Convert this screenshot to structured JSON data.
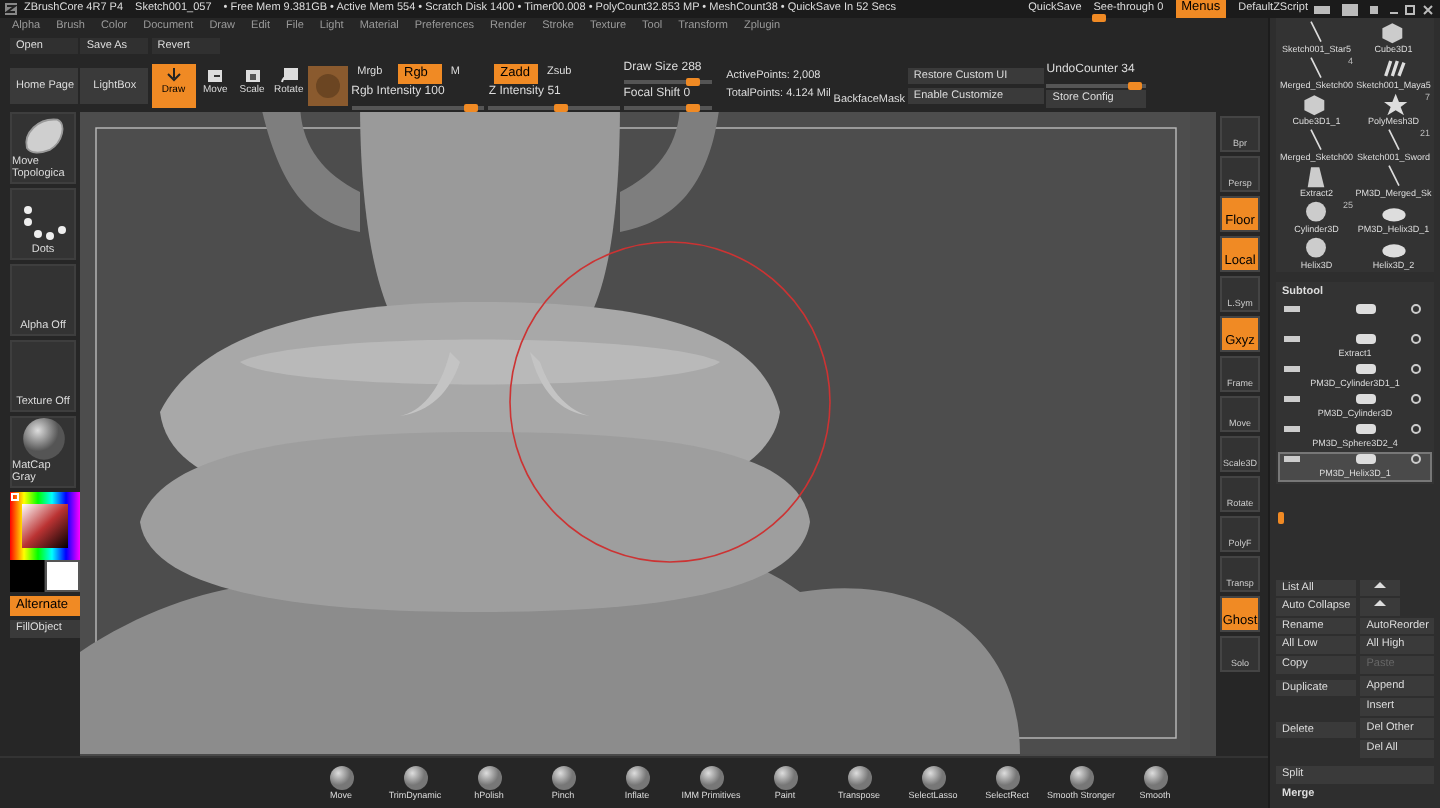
{
  "title_bar": {
    "app": "ZBrushCore 4R7 P4",
    "document": "Sketch001_057",
    "stats": "• Free Mem 9.381GB • Active Mem 554 • Scratch Disk 1400 • Timer00.008 • PolyCount32.853 MP • MeshCount38 • QuickSave In 52 Secs",
    "quicksave": "QuickSave",
    "see_through": {
      "label": "See-through  0",
      "level": 0.05
    },
    "menus": {
      "label": "Menus",
      "on": true
    },
    "script": "DefaultZScript"
  },
  "menu_bar": [
    "Alpha",
    "Brush",
    "Color",
    "Document",
    "Draw",
    "Edit",
    "File",
    "Light",
    "Material",
    "Preferences",
    "Render",
    "Stroke",
    "Texture",
    "Tool",
    "Transform",
    "Zplugin"
  ],
  "file_buttons": [
    "Open",
    "Save As",
    "Revert"
  ],
  "toolbar": {
    "buttons": [
      "Home Page",
      "LightBox"
    ],
    "modes": [
      {
        "label": "Draw",
        "selected": true,
        "kind": "draw"
      },
      {
        "label": "Move",
        "selected": false,
        "kind": "move"
      },
      {
        "label": "Scale",
        "selected": false,
        "kind": "scale"
      },
      {
        "label": "Rotate",
        "selected": false,
        "kind": "rotate"
      }
    ],
    "color_modes": [
      {
        "label": "Mrgb",
        "selected": false
      },
      {
        "label": "Rgb",
        "selected": true
      },
      {
        "label": "M",
        "selected": false
      }
    ],
    "z_modes": [
      {
        "label": "Zadd",
        "selected": true
      },
      {
        "label": "Zsub",
        "selected": false
      }
    ],
    "intensity": [
      {
        "label": "Rgb Intensity 100",
        "level": 0.95
      },
      {
        "label": "Z Intensity 51",
        "level": 0.55
      }
    ],
    "draw": [
      {
        "label": "Draw Size 288",
        "level": 0.85
      },
      {
        "label": "Focal Shift 0",
        "level": 0.85
      }
    ],
    "points": [
      "ActivePoints: 2,008",
      "TotalPoints: 4.124 Mil"
    ],
    "backface": "BackfaceMask",
    "custom": [
      "Restore Custom UI",
      "Enable Customize"
    ],
    "undo": {
      "label": "UndoCounter 34",
      "level": 0.95
    },
    "store": "Store Config"
  },
  "left_shelf": [
    {
      "label": "Move Topologica",
      "kind": "brush"
    },
    {
      "label": "Dots",
      "kind": "stroke"
    },
    {
      "label": "Alpha Off",
      "kind": "empty"
    },
    {
      "label": "Texture Off",
      "kind": "empty"
    },
    {
      "label": "MatCap Gray",
      "kind": "material"
    }
  ],
  "alternate": {
    "label": "Alternate",
    "on": true
  },
  "fill_object": "FillObject",
  "canvas": {
    "kind": "picture"
  },
  "right_shelf": [
    {
      "label": "Bpr",
      "on": false
    },
    {
      "label": "Persp",
      "on": false
    },
    {
      "label": "Floor",
      "on": true
    },
    {
      "label": "Local",
      "on": true
    },
    {
      "label": "L.Sym",
      "on": false
    },
    {
      "label": "Gxyz",
      "on": true
    },
    {
      "label": "Frame",
      "on": false
    },
    {
      "label": "Move",
      "on": false
    },
    {
      "label": "Scale3D",
      "on": false
    },
    {
      "label": "Rotate",
      "on": false
    },
    {
      "label": "PolyF",
      "on": false
    },
    {
      "label": "Transp",
      "on": false
    },
    {
      "label": "Ghost",
      "on": true
    },
    {
      "label": "Solo",
      "on": false
    }
  ],
  "tools": [
    {
      "name": "Sketch001_Star5",
      "kind": "stick"
    },
    {
      "name": "Cube3D1",
      "kind": "cube"
    },
    {
      "name": "Merged_Sketch00",
      "kind": "stick",
      "count": "4"
    },
    {
      "name": "Sketch001_Maya5",
      "kind": "claws"
    },
    {
      "name": "Cube3D1_1",
      "kind": "cube"
    },
    {
      "name": "PolyMesh3D",
      "kind": "star",
      "count": "7"
    },
    {
      "name": "Merged_Sketch00",
      "kind": "stick"
    },
    {
      "name": "Sketch001_Sword",
      "kind": "stick",
      "count": "21"
    },
    {
      "name": "Extract2",
      "kind": "cone"
    },
    {
      "name": "PM3D_Merged_Sk",
      "kind": "stick"
    },
    {
      "name": "Cylinder3D",
      "kind": "cylinder",
      "count": "25"
    },
    {
      "name": "PM3D_Helix3D_1",
      "kind": "helix"
    },
    {
      "name": "Helix3D",
      "kind": "cylinder"
    },
    {
      "name": "Helix3D_2",
      "kind": "helix"
    }
  ],
  "subtool": {
    "title": "Subtool",
    "items": [
      {
        "selected": false
      },
      {
        "name": "Extract1",
        "selected": false
      },
      {
        "name": "PM3D_Cylinder3D1_1",
        "selected": false
      },
      {
        "name": "PM3D_Cylinder3D",
        "selected": false
      },
      {
        "name": "PM3D_Sphere3D2_4",
        "selected": false
      },
      {
        "name": "PM3D_Helix3D_1",
        "selected": true
      }
    ]
  },
  "subtool_buttons": [
    {
      "label": "List All",
      "kind": "pair"
    },
    {
      "label": "Auto Collapse",
      "kind": "pair"
    },
    {
      "label": "Rename",
      "kind": "btn"
    },
    {
      "label": "AutoReorder",
      "kind": "btn"
    },
    {
      "label": "All Low",
      "kind": "btn"
    },
    {
      "label": "All High",
      "kind": "btn"
    },
    {
      "label": "Copy",
      "kind": "btn"
    },
    {
      "label": "Paste",
      "kind": "off"
    },
    {
      "label": "Duplicate",
      "kind": "tall"
    },
    {
      "label": "Append",
      "kind": "btn"
    },
    {
      "label": "Insert",
      "kind": "btn"
    },
    {
      "label": "Delete",
      "kind": "tall"
    },
    {
      "label": "Del Other",
      "kind": "btn"
    },
    {
      "label": "Del All",
      "kind": "btn"
    },
    {
      "label": "Split",
      "kind": "wide"
    },
    {
      "label": "Merge",
      "kind": "head"
    }
  ],
  "brushes": [
    "Move",
    "TrimDynamic",
    "hPolish",
    "Pinch",
    "Inflate",
    "IMM Primitives",
    "Paint",
    "Transpose",
    "SelectLasso",
    "SelectRect",
    "Smooth Stronger",
    "Smooth"
  ]
}
